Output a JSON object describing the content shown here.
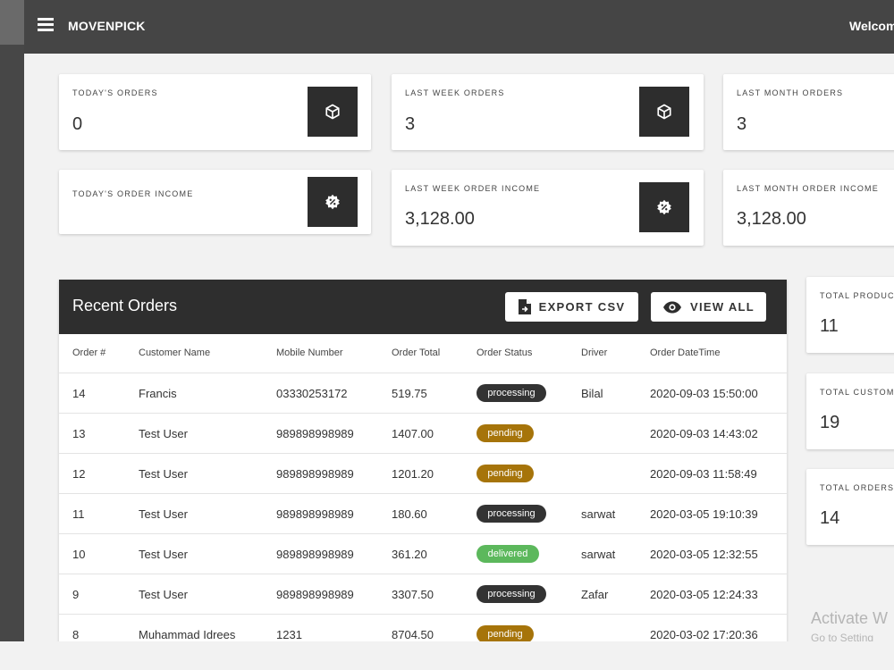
{
  "header": {
    "brand": "MOVENPICK",
    "welcome": "Welcom"
  },
  "stats": {
    "todays_orders": {
      "label": "TODAY'S ORDERS",
      "value": "0",
      "icon": "box-icon"
    },
    "last_week_orders": {
      "label": "LAST WEEK ORDERS",
      "value": "3",
      "icon": "box-icon"
    },
    "last_month_orders": {
      "label": "LAST MONTH ORDERS",
      "value": "3"
    },
    "todays_income": {
      "label": "TODAY'S ORDER INCOME",
      "value": "",
      "icon": "percent-badge-icon"
    },
    "last_week_income": {
      "label": "LAST WEEK ORDER INCOME",
      "value": "3,128.00",
      "icon": "percent-badge-icon"
    },
    "last_month_income": {
      "label": "LAST MONTH ORDER INCOME",
      "value": "3,128.00"
    },
    "total_products": {
      "label": "TOTAL PRODUC",
      "value": "11"
    },
    "total_customers": {
      "label": "TOTAL CUSTOM",
      "value": "19"
    },
    "total_orders": {
      "label": "TOTAL ORDERS",
      "value": "14"
    }
  },
  "recent_orders": {
    "title": "Recent Orders",
    "export_label": "EXPORT CSV",
    "view_all_label": "VIEW ALL",
    "columns": [
      "Order #",
      "Customer Name",
      "Mobile Number",
      "Order Total",
      "Order Status",
      "Driver",
      "Order DateTime"
    ],
    "rows": [
      {
        "order": "14",
        "customer": "Francis",
        "mobile": "03330253172",
        "total": "519.75",
        "status": "processing",
        "driver": "Bilal",
        "datetime": "2020-09-03 15:50:00"
      },
      {
        "order": "13",
        "customer": "Test User",
        "mobile": "989898998989",
        "total": "1407.00",
        "status": "pending",
        "driver": "",
        "datetime": "2020-09-03 14:43:02"
      },
      {
        "order": "12",
        "customer": "Test User",
        "mobile": "989898998989",
        "total": "1201.20",
        "status": "pending",
        "driver": "",
        "datetime": "2020-09-03 11:58:49"
      },
      {
        "order": "11",
        "customer": "Test User",
        "mobile": "989898998989",
        "total": "180.60",
        "status": "processing",
        "driver": "sarwat",
        "datetime": "2020-03-05 19:10:39"
      },
      {
        "order": "10",
        "customer": "Test User",
        "mobile": "989898998989",
        "total": "361.20",
        "status": "delivered",
        "driver": "sarwat",
        "datetime": "2020-03-05 12:32:55"
      },
      {
        "order": "9",
        "customer": "Test User",
        "mobile": "989898998989",
        "total": "3307.50",
        "status": "processing",
        "driver": "Zafar",
        "datetime": "2020-03-05 12:24:33"
      },
      {
        "order": "8",
        "customer": "Muhammad Idrees",
        "mobile": "1231",
        "total": "8704.50",
        "status": "pending",
        "driver": "",
        "datetime": "2020-03-02 17:20:36"
      }
    ]
  },
  "status_colors": {
    "processing": "#333333",
    "pending": "#a6740a",
    "delivered": "#5cb85c"
  },
  "watermark": {
    "title": "Activate W",
    "subtitle": "Go to Setting"
  }
}
